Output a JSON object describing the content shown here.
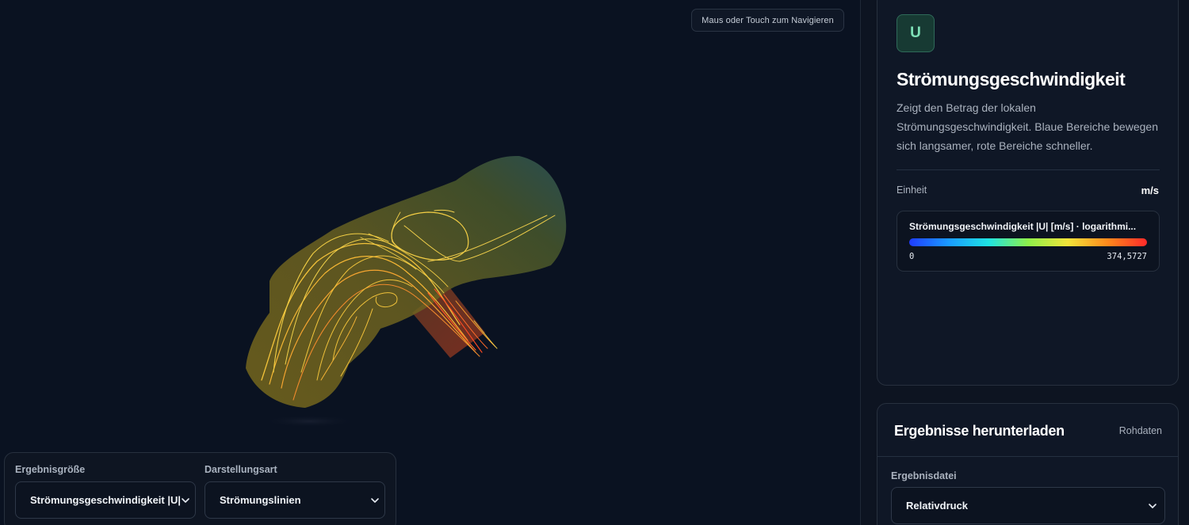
{
  "viewport": {
    "nav_hint": "Maus oder Touch zum Navigieren"
  },
  "controls": {
    "result_quantity": {
      "label": "Ergebnisgröße",
      "value": "Strömungsgeschwindigkeit |U| [m"
    },
    "display_mode": {
      "label": "Darstellungsart",
      "value": "Strömungslinien"
    }
  },
  "info": {
    "badge": "U",
    "title": "Strömungsgeschwindigkeit",
    "description": "Zeigt den Betrag der lokalen Strömungsgeschwindigkeit. Blaue Bereiche bewegen sich langsamer, rote Bereiche schneller.",
    "unit_label": "Einheit",
    "unit_value": "m/s",
    "legend": {
      "title": "Strömungsgeschwindigkeit |U| [m/s] · logarithmi...",
      "min": "0",
      "max": "374,5727",
      "colors": [
        "#1f3cff",
        "#1a9bff",
        "#1ee3e3",
        "#8ef04a",
        "#f2e43a",
        "#ff8a1c",
        "#ff2a2a"
      ]
    }
  },
  "download": {
    "title": "Ergebnisse herunterladen",
    "raw_link": "Rohdaten",
    "file_label": "Ergebnisdatei",
    "file_value": "Relativdruck"
  }
}
